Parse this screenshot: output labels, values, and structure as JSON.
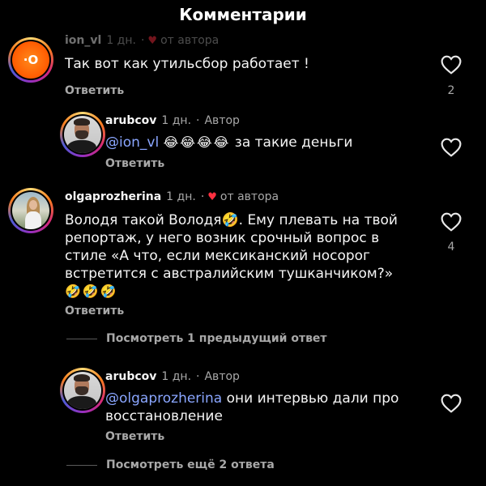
{
  "header": {
    "title": "Комментарии"
  },
  "comments": [
    {
      "username": "ion_vl",
      "age": "1 дн.",
      "author_tag": "от автора",
      "text": "Так вот как утильсбор работает !",
      "reply_label": "Ответить",
      "like_count": "2"
    },
    {
      "username": "arubcov",
      "age": "1 дн.",
      "author_tag": "Автор",
      "mention": "@ion_vl",
      "emoji": "😂😂😂😂",
      "text": "за такие деньги",
      "reply_label": "Ответить"
    },
    {
      "username": "olgaprozherina",
      "age": "1 дн.",
      "author_tag": "от автора",
      "line1": "Володя такой Володя🤣. Ему плевать на твой",
      "line2": "репортаж, у него возник срочный вопрос в",
      "line3": "стиле «А что, если мексиканский носорог",
      "line4": "встретится с австралийским тушканчиком?»",
      "emoji": "🤣🤣🤣",
      "reply_label": "Ответить",
      "like_count": "4",
      "view_previous": "Посмотреть 1 предыдущий ответ"
    },
    {
      "username": "arubcov",
      "age": "1 дн.",
      "author_tag": "Автор",
      "mention": "@olgaprozherina",
      "line1": "они интервью дали про",
      "line2": "восстановление",
      "reply_label": "Ответить",
      "view_more": "Посмотреть ещё 2 ответа"
    }
  ],
  "colors": {
    "background": "#000000",
    "mention": "#8aa6ff",
    "heart_red": "#ff3040",
    "muted": "#a8a8a8"
  }
}
